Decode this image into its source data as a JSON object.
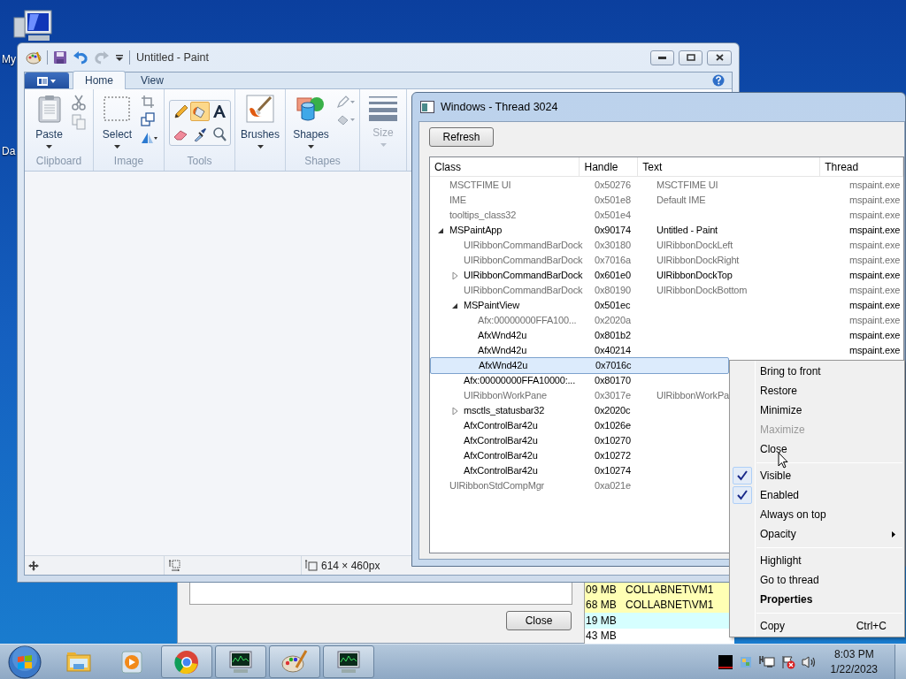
{
  "desktop": {
    "icons": [
      {
        "label": "My"
      },
      {
        "label": "Da"
      }
    ]
  },
  "paint": {
    "title": "Untitled - Paint",
    "tabs": [
      {
        "label": "Home",
        "selected": true
      },
      {
        "label": "View",
        "selected": false
      }
    ],
    "big_buttons": [
      {
        "label": "Paste",
        "disabled": false
      },
      {
        "label": "Select",
        "disabled": false
      },
      {
        "label": "Brushes",
        "disabled": false
      },
      {
        "label": "Shapes",
        "disabled": false
      },
      {
        "label": "Size",
        "disabled": true
      }
    ],
    "group_labels": [
      "Clipboard",
      "Image",
      "Tools",
      "Shapes"
    ],
    "tools": [
      {
        "selected": false
      },
      {
        "selected": true
      },
      {
        "selected": false
      },
      {
        "selected": false
      },
      {
        "selected": false
      },
      {
        "selected": false
      }
    ],
    "status_bar": {
      "canvas_size": "614 × 460px"
    }
  },
  "background_window": {
    "close_button": "Close",
    "rows": [
      {
        "size": "09 MB",
        "user": "COLLABNET\\VM1",
        "color": "#ffffb4"
      },
      {
        "size": "68 MB",
        "user": "COLLABNET\\VM1",
        "color": "#ffffb4"
      },
      {
        "size": "19 MB",
        "color": "#d6ffff"
      },
      {
        "size": "43 MB",
        "color": "#ffffff"
      }
    ]
  },
  "thread_window": {
    "title": "Windows - Thread 3024",
    "refresh_button": "Refresh",
    "columns": [
      "Class",
      "Handle",
      "Text",
      "Thread"
    ],
    "rows": [
      {
        "class": "MSCTFIME UI",
        "handle": "0x50276",
        "text": "MSCTFIME UI",
        "thread": "mspaint.exe",
        "dimmed": true,
        "selected": false
      },
      {
        "class": "IME",
        "handle": "0x501e8",
        "text": "Default IME",
        "thread": "mspaint.exe",
        "dimmed": true,
        "selected": false
      },
      {
        "class": "tooltips_class32",
        "handle": "0x501e4",
        "thread": "mspaint.exe",
        "dimmed": true,
        "selected": false
      },
      {
        "class": "MSPaintApp",
        "handle": "0x90174",
        "text": "Untitled - Paint",
        "thread": "mspaint.exe",
        "dimmed": false,
        "selected": false,
        "expanded": true,
        "children": [
          {
            "class": "UIRibbonCommandBarDock",
            "handle": "0x30180",
            "text": "UIRibbonDockLeft",
            "thread": "mspaint.exe",
            "dimmed": true,
            "selected": false
          },
          {
            "class": "UIRibbonCommandBarDock",
            "handle": "0x7016a",
            "text": "UIRibbonDockRight",
            "thread": "mspaint.exe",
            "dimmed": true,
            "selected": false
          },
          {
            "class": "UIRibbonCommandBarDock",
            "handle": "0x601e0",
            "text": "UIRibbonDockTop",
            "thread": "mspaint.exe",
            "dimmed": false,
            "selected": false,
            "expanded": false
          },
          {
            "class": "UIRibbonCommandBarDock",
            "handle": "0x80190",
            "text": "UIRibbonDockBottom",
            "thread": "mspaint.exe",
            "dimmed": true,
            "selected": false
          },
          {
            "class": "MSPaintView",
            "handle": "0x501ec",
            "thread": "mspaint.exe",
            "dimmed": false,
            "selected": false,
            "expanded": true,
            "children": [
              {
                "class": "Afx:00000000FFA100...",
                "handle": "0x2020a",
                "thread": "mspaint.exe",
                "dimmed": true,
                "selected": false
              },
              {
                "class": "AfxWnd42u",
                "handle": "0x801b2",
                "thread": "mspaint.exe",
                "dimmed": false,
                "selected": false
              },
              {
                "class": "AfxWnd42u",
                "handle": "0x40214",
                "thread": "mspaint.exe",
                "dimmed": false,
                "selected": false
              },
              {
                "class": "AfxWnd42u",
                "handle": "0x7016c",
                "dimmed": false,
                "selected": true
              }
            ]
          },
          {
            "class": "Afx:00000000FFA10000:...",
            "handle": "0x80170",
            "dimmed": false,
            "selected": false
          },
          {
            "class": "UIRibbonWorkPane",
            "handle": "0x3017e",
            "text": "UIRibbonWorkPa",
            "dimmed": true,
            "selected": false
          },
          {
            "class": "msctls_statusbar32",
            "handle": "0x2020c",
            "dimmed": false,
            "selected": false,
            "expanded": false
          },
          {
            "class": "AfxControlBar42u",
            "handle": "0x1026e",
            "dimmed": false,
            "selected": false
          },
          {
            "class": "AfxControlBar42u",
            "handle": "0x10270",
            "dimmed": false,
            "selected": false
          },
          {
            "class": "AfxControlBar42u",
            "handle": "0x10272",
            "dimmed": false,
            "selected": false
          },
          {
            "class": "AfxControlBar42u",
            "handle": "0x10274",
            "dimmed": false,
            "selected": false
          }
        ]
      },
      {
        "class": "UIRibbonStdCompMgr",
        "handle": "0xa021e",
        "dimmed": true,
        "selected": false
      }
    ]
  },
  "context_menu": {
    "items": [
      {
        "kind": "item",
        "label": "Bring to front",
        "checked": false,
        "disabled": false,
        "default": false,
        "submenu": false
      },
      {
        "kind": "item",
        "label": "Restore",
        "checked": false,
        "disabled": false,
        "default": false,
        "submenu": false
      },
      {
        "kind": "item",
        "label": "Minimize",
        "checked": false,
        "disabled": false,
        "default": false,
        "submenu": false
      },
      {
        "kind": "item",
        "label": "Maximize",
        "checked": false,
        "disabled": true,
        "default": false,
        "submenu": false
      },
      {
        "kind": "item",
        "label": "Close",
        "checked": false,
        "disabled": false,
        "default": false,
        "submenu": false
      },
      {
        "kind": "separator"
      },
      {
        "kind": "item",
        "label": "Visible",
        "checked": true,
        "disabled": false,
        "default": false,
        "submenu": false
      },
      {
        "kind": "item",
        "label": "Enabled",
        "checked": true,
        "disabled": false,
        "default": false,
        "submenu": false
      },
      {
        "kind": "item",
        "label": "Always on top",
        "checked": false,
        "disabled": false,
        "default": false,
        "submenu": false
      },
      {
        "kind": "item",
        "label": "Opacity",
        "checked": false,
        "disabled": false,
        "default": false,
        "submenu": true
      },
      {
        "kind": "separator"
      },
      {
        "kind": "item",
        "label": "Highlight",
        "checked": false,
        "disabled": false,
        "default": false,
        "submenu": false
      },
      {
        "kind": "item",
        "label": "Go to thread",
        "checked": false,
        "disabled": false,
        "default": false,
        "submenu": false
      },
      {
        "kind": "item",
        "label": "Properties",
        "checked": false,
        "disabled": false,
        "default": true,
        "submenu": false
      },
      {
        "kind": "separator"
      },
      {
        "kind": "item",
        "label": "Copy",
        "shortcut": "Ctrl+C",
        "checked": false,
        "disabled": false,
        "default": false,
        "submenu": false
      }
    ]
  },
  "taskbar": {
    "buttons": [
      {
        "kind": "folder",
        "running": false
      },
      {
        "kind": "player",
        "running": false
      },
      {
        "kind": "browser",
        "running": true
      },
      {
        "kind": "monitor",
        "running": true
      },
      {
        "kind": "paint",
        "running": true
      },
      {
        "kind": "monitor",
        "running": true
      }
    ],
    "clock": {
      "time": "8:03 PM",
      "date": "1/22/2023"
    }
  }
}
